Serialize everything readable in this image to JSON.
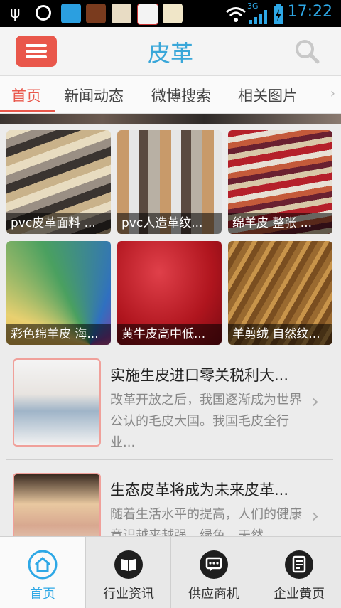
{
  "status_bar": {
    "time": "17:22",
    "network": "3G"
  },
  "header": {
    "title": "皮革",
    "accent_color": "#e9574b",
    "title_color": "#3aa7d9"
  },
  "tabs": [
    {
      "label": "首页",
      "active": true
    },
    {
      "label": "新闻动态"
    },
    {
      "label": "微博搜索"
    },
    {
      "label": "相关图片"
    }
  ],
  "grid_items": [
    {
      "caption": "pvc皮革面料 ..."
    },
    {
      "caption": "pvc人造革纹..."
    },
    {
      "caption": "绵羊皮 整张 ..."
    },
    {
      "caption": "彩色绵羊皮 海..."
    },
    {
      "caption": "黄牛皮高中低..."
    },
    {
      "caption": "羊剪绒 自然纹..."
    }
  ],
  "news": [
    {
      "title": "实施生皮进口零关税利大...",
      "desc": "改革开放之后，我国逐渐成为世界公认的毛皮大国。我国毛皮全行业..."
    },
    {
      "title": "生态皮革将成为未来皮革...",
      "desc": "随着生活水平的提高，人们的健康意识越来越强，绿色，天然..."
    }
  ],
  "bottom_nav": [
    {
      "label": "首页",
      "icon": "home-icon",
      "active": true
    },
    {
      "label": "行业资讯",
      "icon": "book-icon"
    },
    {
      "label": "供应商机",
      "icon": "chat-icon"
    },
    {
      "label": "企业黄页",
      "icon": "document-icon"
    }
  ]
}
